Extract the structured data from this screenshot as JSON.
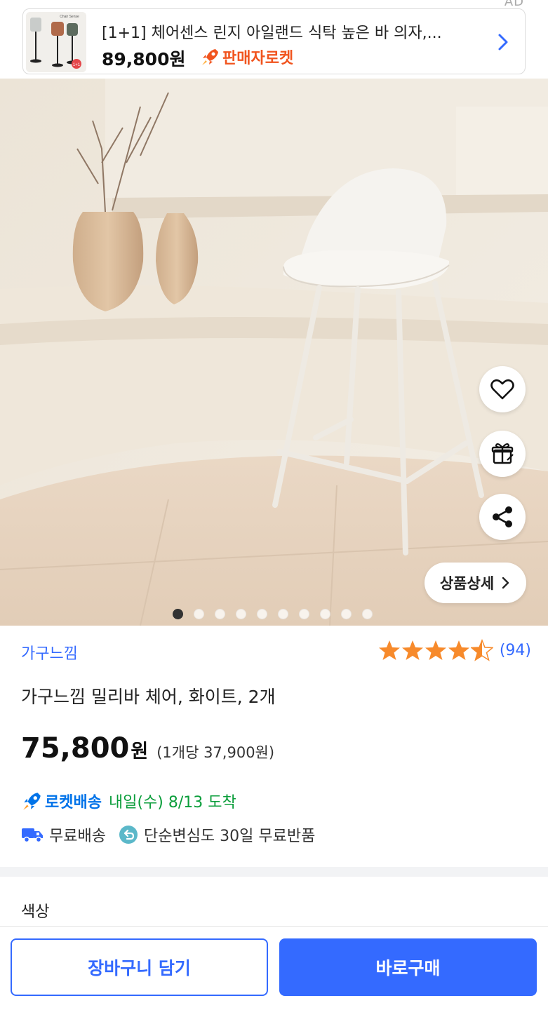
{
  "ad": {
    "label": "AD",
    "title": "[1+1] 체어센스 린지 아일랜드 식탁 높은 바 의자,...",
    "price": "89,800원",
    "badge": "판매자로켓",
    "thumb_badge": "1+1",
    "thumb_text": "Chair Sense"
  },
  "hero": {
    "detail_button": "상품상세",
    "carousel": {
      "total": 10,
      "current": 1
    },
    "actions": [
      "heart-icon",
      "gift-icon",
      "share-icon"
    ]
  },
  "product": {
    "brand": "가구느낌",
    "rating": {
      "stars": 4.5,
      "count": "(94)"
    },
    "name": "가구느낌 밀리바 체어, 화이트, 2개",
    "price": "75,800",
    "price_unit": "원",
    "unit_price": "(1개당 37,900원)",
    "delivery": {
      "label": "로켓배송",
      "arrival": "내일(수) 8/13 도착"
    },
    "shipping": {
      "free": "무료배송",
      "return": "단순변심도 30일 무료반품"
    }
  },
  "options": {
    "label": "색상"
  },
  "buttons": {
    "cart": "장바구니 담기",
    "buy": "바로구매"
  },
  "colors": {
    "accent": "#346aff",
    "rocket_blue": "#0073e9",
    "arrival_green": "#0a9d3a",
    "seller_rocket": "#f1541e",
    "star": "#f78a2b"
  }
}
